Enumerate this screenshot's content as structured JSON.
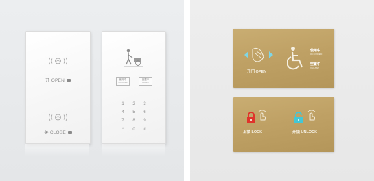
{
  "left_tile": {
    "open_panel": {
      "rfid_icon_top": "((฿))",
      "rfid_icon_bottom": "((฿))",
      "open_label": "开 OPEN",
      "close_label": "关 CLOSE"
    },
    "keypad_panel": {
      "status_occupied_cn": "使用中",
      "status_occupied_en": "OCCUPIED",
      "status_vacant_cn": "空置中",
      "status_vacant_en": "VACANT",
      "keys": [
        "1",
        "2",
        "3",
        "4",
        "5",
        "6",
        "7",
        "8",
        "9",
        "*",
        "0",
        "#"
      ]
    }
  },
  "right_tile": {
    "open_panel": {
      "open_label_cn": "开门",
      "open_label_en": "OPEN",
      "occupied_cn": "使用中",
      "occupied_en": "OCCUPIED",
      "vacant_cn": "空置中",
      "vacant_en": "VACANT",
      "arrow_color": "#7fd6e6"
    },
    "lock_panel": {
      "lock_cn": "上锁",
      "lock_en": "LOCK",
      "unlock_cn": "开锁",
      "unlock_en": "UNLOCK",
      "lock_color": "#e0332b",
      "unlock_color": "#43c7d6"
    }
  }
}
